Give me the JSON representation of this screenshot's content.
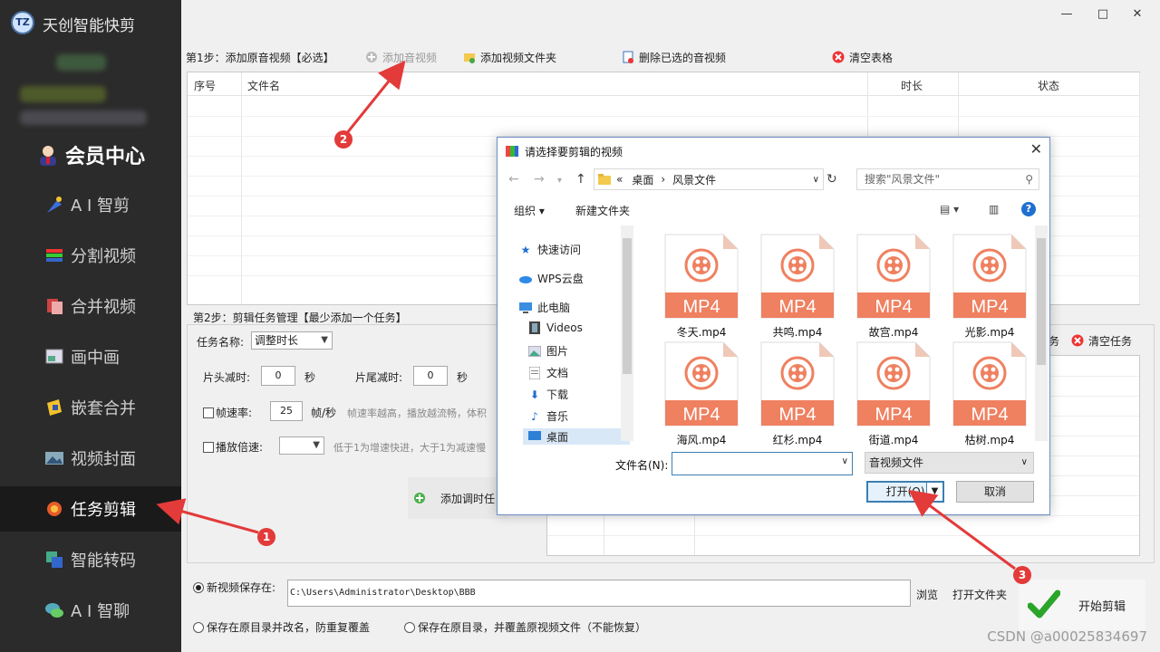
{
  "app": {
    "title": "天创智能快剪",
    "logo": "TZ"
  },
  "sidebar": {
    "vip_label": "会员中心",
    "items": [
      {
        "label": "A I 智剪",
        "icon": "ai-cut-icon"
      },
      {
        "label": "分割视频",
        "icon": "split-video-icon"
      },
      {
        "label": "合并视频",
        "icon": "merge-video-icon"
      },
      {
        "label": "画中画",
        "icon": "pip-icon"
      },
      {
        "label": "嵌套合并",
        "icon": "nest-merge-icon"
      },
      {
        "label": "视频封面",
        "icon": "video-cover-icon"
      },
      {
        "label": "任务剪辑",
        "icon": "task-edit-icon"
      },
      {
        "label": "智能转码",
        "icon": "transcode-icon"
      },
      {
        "label": "A I 智聊",
        "icon": "ai-chat-icon"
      }
    ],
    "active": "任务剪辑"
  },
  "window": {
    "min": "—",
    "max": "□",
    "close": "✕"
  },
  "step1": {
    "label": "第1步：添加原音视频【必选】",
    "add_video": "添加音视频",
    "add_folder": "添加视频文件夹",
    "delete_selected": "删除已选的音视频",
    "clear_table": "清空表格",
    "columns": [
      "序号",
      "文件名",
      "时长",
      "状态"
    ]
  },
  "step2": {
    "label": "第2步：剪辑任务管理【最少添加一个任务】",
    "task_name_label": "任务名称:",
    "task_name_value": "调整时长",
    "head_cut_label": "片头减时:",
    "head_cut_value": "0",
    "tail_cut_label": "片尾减时:",
    "tail_cut_value": "0",
    "seconds": "秒",
    "fps_label": "帧速率:",
    "fps_value": "25",
    "fps_unit": "帧/秒",
    "fps_hint": "帧速率越高，播放越流畅，体积",
    "speed_label": "播放倍速:",
    "speed_hint": "低于1为增速快进，大于1为减速慢",
    "add_task_button": "添加调时任",
    "task_partial": "务",
    "clear_tasks": "清空任务"
  },
  "save": {
    "new_save_label": "新视频保存在:",
    "path": "C:\\Users\\Administrator\\Desktop\\BBB",
    "browse": "浏览",
    "open_folder": "打开文件夹",
    "opt_rename": "保存在原目录并改名，防重复覆盖",
    "opt_overwrite": "保存在原目录，并覆盖原视频文件（不能恢复）",
    "start": "开始剪辑"
  },
  "dialog": {
    "title": "请选择要剪辑的视频",
    "breadcrumb": [
      "«",
      "桌面",
      "›",
      "风景文件"
    ],
    "search_placeholder": "搜索\"风景文件\"",
    "organize": "组织 ▾",
    "new_folder": "新建文件夹",
    "tree": [
      "快速访问",
      "WPS云盘",
      "此电脑",
      "Videos",
      "图片",
      "文档",
      "下载",
      "音乐",
      "桌面"
    ],
    "files": [
      "冬天.mp4",
      "共鸣.mp4",
      "故宫.mp4",
      "光影.mp4",
      "海风.mp4",
      "红杉.mp4",
      "街道.mp4",
      "枯树.mp4"
    ],
    "file_badge": "MP4",
    "filename_label": "文件名(N):",
    "filetype": "音视频文件",
    "open": "打开(O)",
    "cancel": "取消",
    "close": "✕"
  },
  "annotations": [
    "1",
    "2",
    "3"
  ],
  "watermark": "CSDN @a00025834697",
  "colors": {
    "sidebar_bg": "#2b2b2b",
    "mp4_accent": "#ef8060",
    "annotation_red": "#e33a3a"
  }
}
